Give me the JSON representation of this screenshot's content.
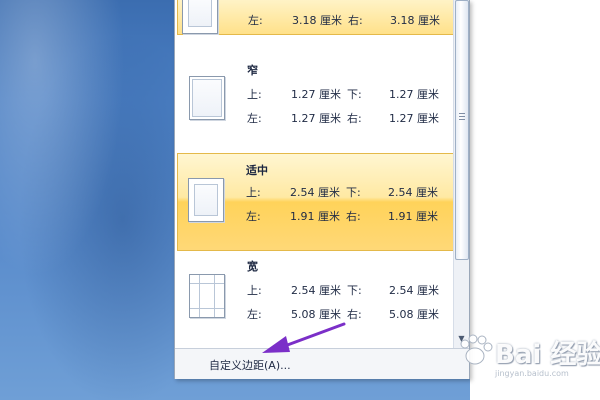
{
  "margins_menu": {
    "items": [
      {
        "title": "",
        "rows": [
          {
            "l1": "左:",
            "v1": "3.18 厘米",
            "l2": "右:",
            "v2": "3.18 厘米"
          }
        ]
      },
      {
        "title": "窄",
        "rows": [
          {
            "l1": "上:",
            "v1": "1.27 厘米",
            "l2": "下:",
            "v2": "1.27 厘米"
          },
          {
            "l1": "左:",
            "v1": "1.27 厘米",
            "l2": "右:",
            "v2": "1.27 厘米"
          }
        ]
      },
      {
        "title": "适中",
        "rows": [
          {
            "l1": "上:",
            "v1": "2.54 厘米",
            "l2": "下:",
            "v2": "2.54 厘米"
          },
          {
            "l1": "左:",
            "v1": "1.91 厘米",
            "l2": "右:",
            "v2": "1.91 厘米"
          }
        ]
      },
      {
        "title": "宽",
        "rows": [
          {
            "l1": "上:",
            "v1": "2.54 厘米",
            "l2": "下:",
            "v2": "2.54 厘米"
          },
          {
            "l1": "左:",
            "v1": "5.08 厘米",
            "l2": "右:",
            "v2": "5.08 厘米"
          }
        ]
      }
    ],
    "footer_label": "自定义边距(A)..."
  },
  "watermark": {
    "text": "Bai 经验",
    "subtext": "jingyan.baidu.com"
  },
  "colors": {
    "selected_highlight": "#ffd35a",
    "arrow": "#7b2fc8",
    "desktop_blue": "#4b7fc3"
  }
}
